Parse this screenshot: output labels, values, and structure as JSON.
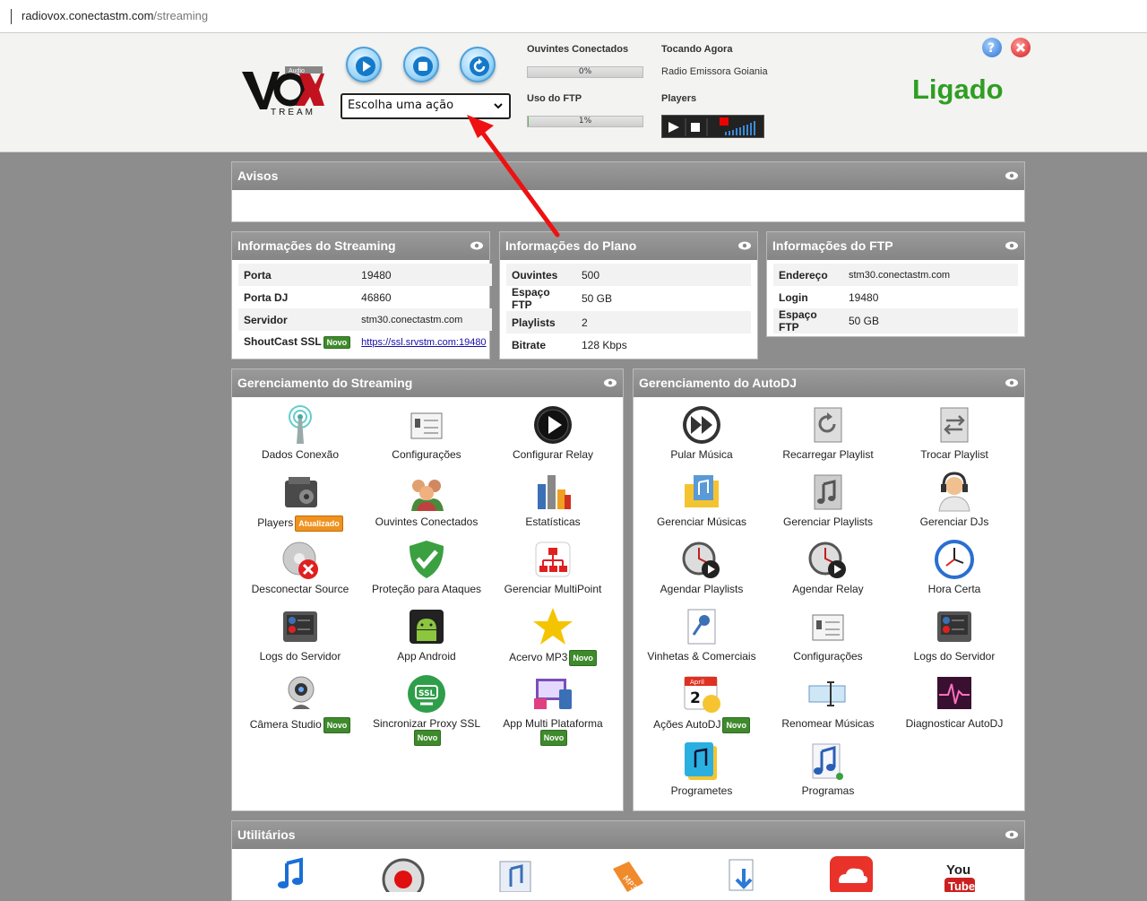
{
  "browser": {
    "url_host": "radiovox.conectastm.com",
    "url_path": "/streaming"
  },
  "header": {
    "logo_text": "VOX",
    "logo_sub": "TREAM",
    "logo_audio": "Audio",
    "action_select": "Escolha uma ação",
    "listeners_label": "Ouvintes Conectados",
    "listeners_pct": "0%",
    "listeners_frac": 0,
    "ftp_label": "Uso do FTP",
    "ftp_pct": "1%",
    "ftp_frac": 0.01,
    "now_playing_label": "Tocando Agora",
    "now_playing": "Radio Emissora Goiania",
    "players_label": "Players",
    "status": "Ligado"
  },
  "avisos": {
    "title": "Avisos"
  },
  "streaming_info": {
    "title": "Informações do Streaming",
    "rows": [
      {
        "k": "Porta",
        "v": "19480"
      },
      {
        "k": "Porta DJ",
        "v": "46860"
      },
      {
        "k": "Servidor",
        "v": "stm30.conectastm.com"
      },
      {
        "k": "ShoutCast SSL",
        "badge": "Novo",
        "v": "https://ssl.srvstm.com:19480"
      }
    ]
  },
  "plan_info": {
    "title": "Informações do Plano",
    "rows": [
      {
        "k": "Ouvintes",
        "v": "500"
      },
      {
        "k": "Espaço FTP",
        "v": "50 GB"
      },
      {
        "k": "Playlists",
        "v": "2"
      },
      {
        "k": "Bitrate",
        "v": "128 Kbps"
      }
    ]
  },
  "ftp_info": {
    "title": "Informações do FTP",
    "rows": [
      {
        "k": "Endereço",
        "v": "stm30.conectastm.com"
      },
      {
        "k": "Login",
        "v": "19480"
      },
      {
        "k": "Espaço FTP",
        "v": "50 GB"
      }
    ]
  },
  "streaming_mgmt": {
    "title": "Gerenciamento do Streaming",
    "items": [
      {
        "label": "Dados Conexão",
        "icon": "antenna-icon"
      },
      {
        "label": "Configurações",
        "icon": "settings-icon"
      },
      {
        "label": "Configurar Relay",
        "icon": "play-circle-icon"
      },
      {
        "label": "Players",
        "badge": "Atualizado",
        "icon": "player-icon"
      },
      {
        "label": "Ouvintes Conectados",
        "icon": "users-icon"
      },
      {
        "label": "Estatísticas",
        "icon": "bar-chart-icon"
      },
      {
        "label": "Desconectar Source",
        "icon": "disconnect-icon"
      },
      {
        "label": "Proteção para Ataques",
        "icon": "shield-icon"
      },
      {
        "label": "Gerenciar MultiPoint",
        "icon": "network-icon"
      },
      {
        "label": "Logs do Servidor",
        "icon": "logs-icon"
      },
      {
        "label": "App Android",
        "icon": "android-icon"
      },
      {
        "label": "Acervo MP3",
        "badge": "Novo",
        "icon": "star-icon"
      },
      {
        "label": "Câmera Studio",
        "badge": "Novo",
        "icon": "webcam-icon"
      },
      {
        "label": "Sincronizar Proxy SSL",
        "badge": "Novo",
        "icon": "ssl-icon"
      },
      {
        "label": "App Multi Plataforma",
        "badge": "Novo",
        "icon": "devices-icon"
      }
    ]
  },
  "autodj_mgmt": {
    "title": "Gerenciamento do AutoDJ",
    "items": [
      {
        "label": "Pular Música",
        "icon": "skip-icon"
      },
      {
        "label": "Recarregar Playlist",
        "icon": "reload-icon"
      },
      {
        "label": "Trocar Playlist",
        "icon": "swap-icon"
      },
      {
        "label": "Gerenciar Músicas",
        "icon": "music-folder-icon"
      },
      {
        "label": "Gerenciar Playlists",
        "icon": "playlist-icon"
      },
      {
        "label": "Gerenciar DJs",
        "icon": "dj-icon"
      },
      {
        "label": "Agendar Playlists",
        "icon": "clock-play-icon"
      },
      {
        "label": "Agendar Relay",
        "icon": "clock-play-icon"
      },
      {
        "label": "Hora Certa",
        "icon": "clock-icon"
      },
      {
        "label": "Vinhetas & Comerciais",
        "icon": "mic-doc-icon"
      },
      {
        "label": "Configurações",
        "icon": "settings-icon"
      },
      {
        "label": "Logs do Servidor",
        "icon": "logs-icon"
      },
      {
        "label": "Ações AutoDJ",
        "badge": "Novo",
        "icon": "calendar-icon",
        "calendar_text": "April",
        "calendar_num": "2"
      },
      {
        "label": "Renomear Músicas",
        "icon": "rename-icon"
      },
      {
        "label": "Diagnosticar AutoDJ",
        "icon": "pulse-icon"
      },
      {
        "label": "Programetes",
        "icon": "note-doc-icon"
      },
      {
        "label": "Programas",
        "icon": "music-note-icon"
      }
    ]
  },
  "utilities": {
    "title": "Utilitários"
  },
  "colors": {
    "accent": "#2f9e23",
    "panel_header": "#8f8f8f",
    "badge_green": "#3f8a2c",
    "badge_orange": "#f0921f",
    "arrow": "#ee1111"
  }
}
